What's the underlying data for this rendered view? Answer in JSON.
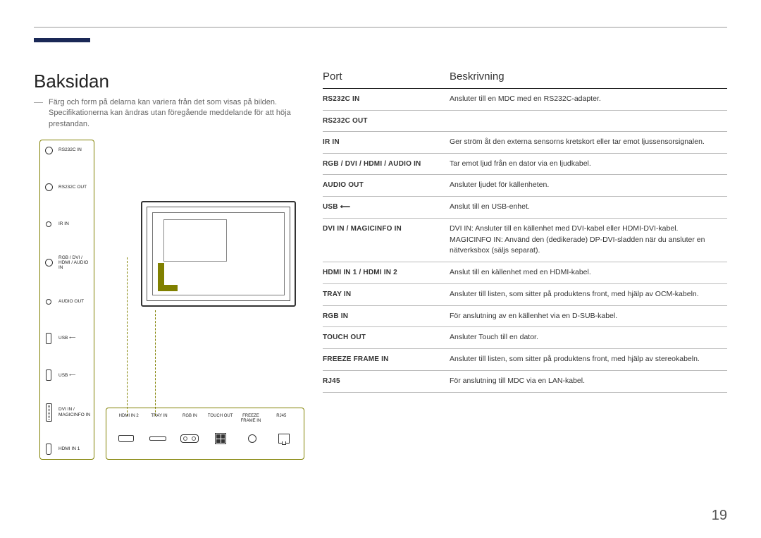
{
  "heading": "Baksidan",
  "note": "Färg och form på delarna kan variera från det som visas på bilden. Specifikationerna kan ändras utan föregående meddelande för att höja prestandan.",
  "page_number": "19",
  "side_ports": [
    {
      "label": "RS232C IN",
      "shape": "circ"
    },
    {
      "label": "RS232C OUT",
      "shape": "circ"
    },
    {
      "label": "IR IN",
      "shape": "circ-small"
    },
    {
      "label": "RGB / DVI / HDMI / AUDIO IN",
      "shape": "circ"
    },
    {
      "label": "AUDIO OUT",
      "shape": "circ-small"
    },
    {
      "label": "USB ⟵",
      "shape": "usb"
    },
    {
      "label": "USB ⟵",
      "shape": "usb"
    },
    {
      "label": "DVI IN / MAGICINFO IN",
      "shape": "dvi"
    },
    {
      "label": "HDMI IN 1",
      "shape": "hdmi"
    }
  ],
  "bottom_ports": [
    "HDMI IN 2",
    "TRAY IN",
    "RGB IN",
    "TOUCH OUT",
    "FREEZE FRAME IN",
    "RJ45"
  ],
  "table_header": {
    "port": "Port",
    "desc": "Beskrivning"
  },
  "table_rows": [
    {
      "port": "RS232C IN",
      "desc": "Ansluter till en MDC med en RS232C-adapter."
    },
    {
      "port": "RS232C OUT",
      "desc": ""
    },
    {
      "port": "IR IN",
      "desc": "Ger ström åt den externa sensorns kretskort eller tar emot ljussensorsignalen."
    },
    {
      "port": "RGB / DVI / HDMI / AUDIO IN",
      "desc": "Tar emot ljud från en dator via en ljudkabel."
    },
    {
      "port": "AUDIO OUT",
      "desc": "Ansluter ljudet för källenheten."
    },
    {
      "port": "USB ⟵",
      "desc": "Anslut till en USB-enhet."
    },
    {
      "port": "DVI IN / MAGICINFO IN",
      "desc": "DVI IN: Ansluter till en källenhet med DVI-kabel eller HDMI-DVI-kabel.\nMAGICINFO IN: Använd den (dedikerade) DP-DVI-sladden när du ansluter en nätverksbox (säljs separat)."
    },
    {
      "port": "HDMI IN 1 / HDMI IN 2",
      "desc": "Anslut till en källenhet med en HDMI-kabel."
    },
    {
      "port": "TRAY IN",
      "desc": "Ansluter till listen, som sitter på produktens front, med hjälp av OCM-kabeln."
    },
    {
      "port": "RGB IN",
      "desc": "För anslutning av en källenhet via en D-SUB-kabel."
    },
    {
      "port": "TOUCH OUT",
      "desc": "Ansluter Touch till en dator."
    },
    {
      "port": "FREEZE FRAME IN",
      "desc": "Ansluter till listen, som sitter på produktens front, med hjälp av stereokabeln."
    },
    {
      "port": "RJ45",
      "desc": "För anslutning till MDC via en LAN-kabel."
    }
  ]
}
